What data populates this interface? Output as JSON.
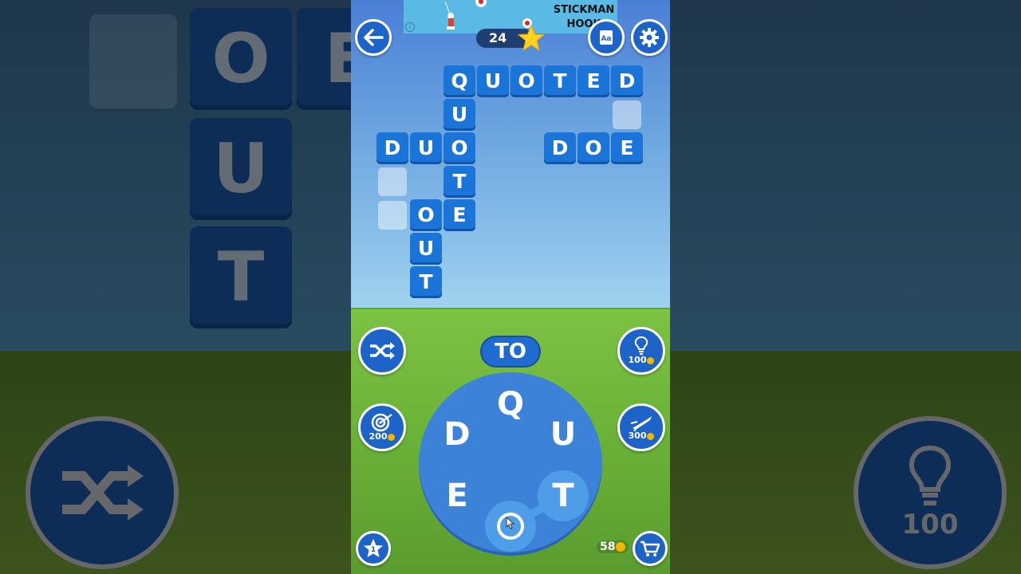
{
  "ad": {
    "title_line1": "STICKMAN",
    "title_line2": "HOOK",
    "info": "i"
  },
  "header": {
    "back_icon": "back-arrow-icon",
    "score": "24",
    "dictionary_icon": "dictionary-icon",
    "settings_icon": "gear-icon"
  },
  "board": {
    "row1": [
      "Q",
      "U",
      "O",
      "T",
      "E",
      "D"
    ],
    "col_quote": [
      "U",
      "O",
      "T",
      "E"
    ],
    "duo": [
      "D",
      "U",
      "O"
    ],
    "doe": [
      "D",
      "O",
      "E"
    ],
    "oe": [
      "O",
      "E"
    ],
    "out": [
      "O",
      "U",
      "T"
    ]
  },
  "current_word": "TO",
  "wheel": {
    "letters": [
      "Q",
      "U",
      "T",
      "O",
      "E",
      "D"
    ]
  },
  "tools": {
    "hint_cost": "100",
    "target_cost": "200",
    "rocket_cost": "300"
  },
  "coins": "58",
  "side": {
    "tile_o": "O",
    "tile_e": "E",
    "tile_u": "U",
    "tile_t": "T",
    "hint_cost": "100"
  },
  "colors": {
    "tile": "#1b74d8",
    "wheel": "#3b82d8",
    "button": "#1e63c7"
  }
}
